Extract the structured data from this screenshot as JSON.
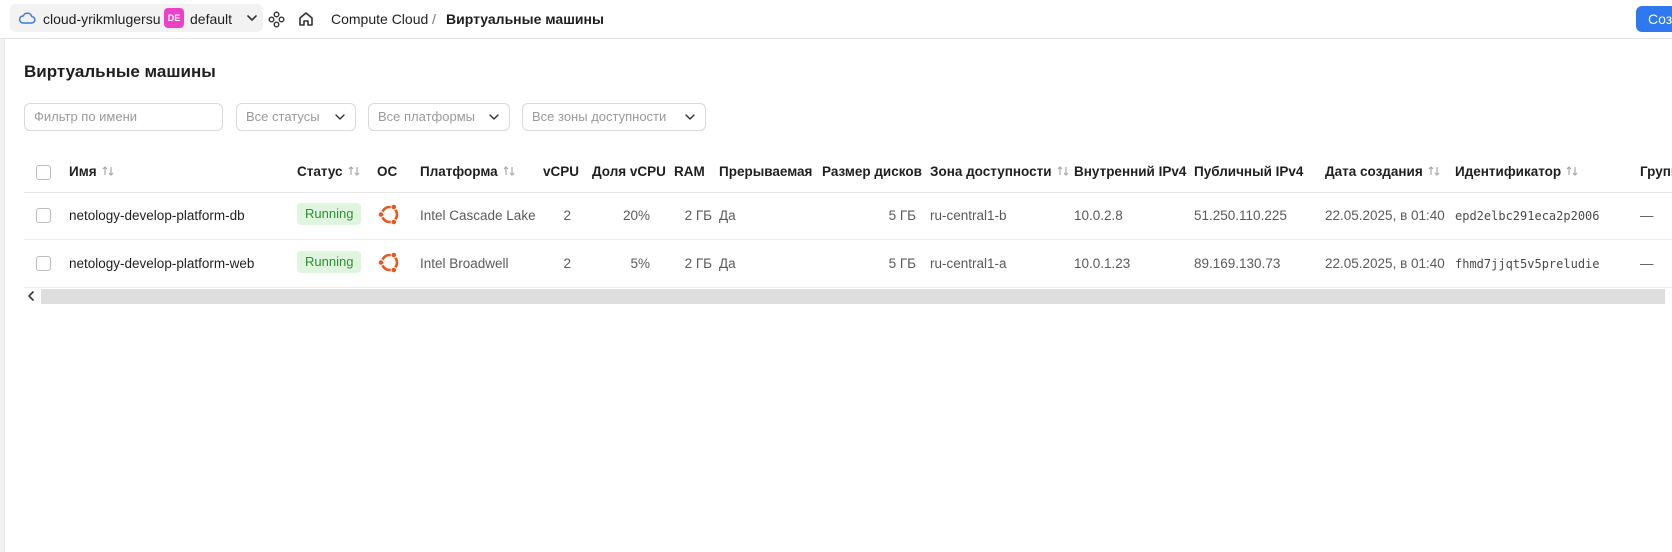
{
  "header": {
    "cloud_name": "cloud-yrikmlugersu",
    "folder_badge": "DE",
    "folder_name": "default",
    "breadcrumb_service": "Compute Cloud",
    "breadcrumb_separator": "/",
    "breadcrumb_current": "Виртуальные машины",
    "create_label": "Соз"
  },
  "page": {
    "title": "Виртуальные машины"
  },
  "filters": {
    "name_placeholder": "Фильтр по имени",
    "status": "Все статусы",
    "platform": "Все платформы",
    "zone": "Все зоны доступности"
  },
  "table": {
    "columns": {
      "name": "Имя",
      "status": "Статус",
      "os": "ОС",
      "platform": "Платформа",
      "vcpu": "vCPU",
      "vcpu_share": "Доля vCPU",
      "ram": "RAM",
      "preemptible": "Прерываемая",
      "disk_size": "Размер дисков",
      "zone": "Зона доступности",
      "internal_ip": "Внутренний IPv4",
      "public_ip": "Публичный IPv4",
      "created": "Дата создания",
      "id": "Идентификатор",
      "group": "Групп"
    },
    "rows": [
      {
        "name": "netology-develop-platform-db",
        "status": "Running",
        "os_icon": "ubuntu-icon",
        "platform": "Intel Cascade Lake",
        "vcpu": "2",
        "vcpu_share": "20%",
        "ram": "2 ГБ",
        "preemptible": "Да",
        "disk_size": "5 ГБ",
        "zone": "ru-central1-b",
        "internal_ip": "10.0.2.8",
        "public_ip": "51.250.110.225",
        "created": "22.05.2025, в 01:40",
        "id": "epd2elbc291eca2p2006",
        "group": "—"
      },
      {
        "name": "netology-develop-platform-web",
        "status": "Running",
        "os_icon": "ubuntu-icon",
        "platform": "Intel Broadwell",
        "vcpu": "2",
        "vcpu_share": "5%",
        "ram": "2 ГБ",
        "preemptible": "Да",
        "disk_size": "5 ГБ",
        "zone": "ru-central1-a",
        "internal_ip": "10.0.1.23",
        "public_ip": "89.169.130.73",
        "created": "22.05.2025, в 01:40",
        "id": "fhmd7jjqt5v5preludie",
        "group": "—"
      }
    ]
  },
  "colors": {
    "accent": "#2e78f0",
    "folder_badge": "#e941c8",
    "status_running_bg": "#dff5de",
    "status_running_text": "#2f8f33",
    "ubuntu": "#e95420"
  }
}
